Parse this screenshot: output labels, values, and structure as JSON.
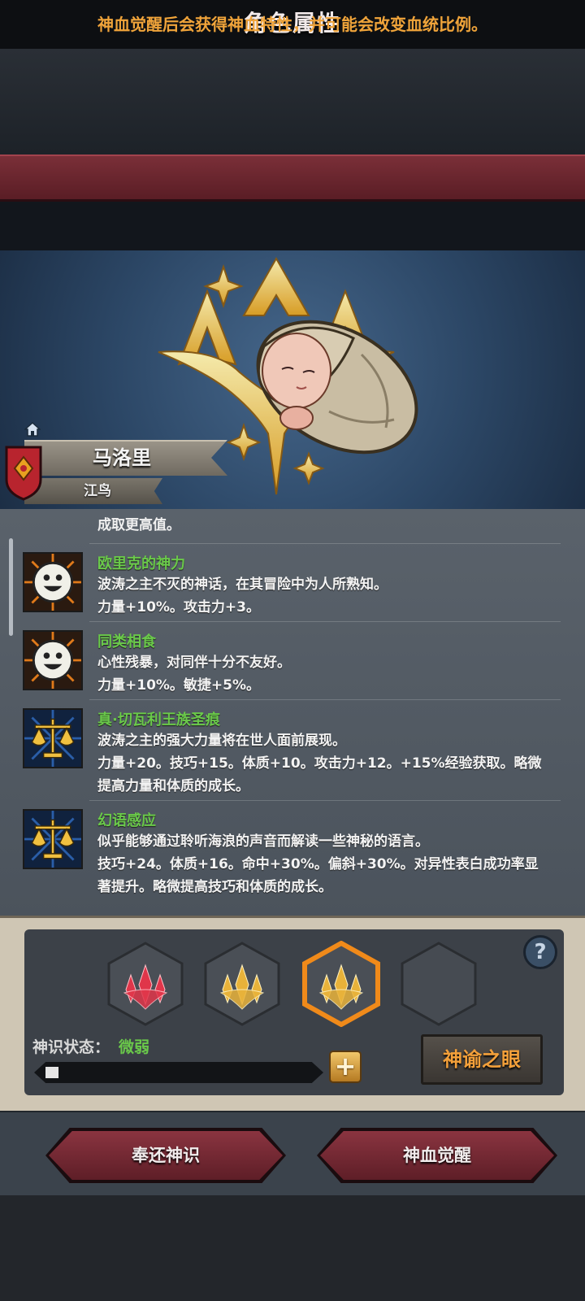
{
  "header": {
    "title": "角色属性"
  },
  "notice": "神血觉醒后会获得神血特性，并可能会改变血统比例。",
  "character": {
    "name": "马洛里",
    "subtitle": "江鸟"
  },
  "traits": {
    "cut_text": "成取更高值。",
    "items": [
      {
        "name": "欧里克的神力",
        "lines": [
          "波涛之主不灭的神话，在其冒险中为人所熟知。",
          "力量+10%。攻击力+3。"
        ],
        "icon": "smiley-face-icon",
        "color": "#e07a1a"
      },
      {
        "name": "同类相食",
        "lines": [
          "心性残暴，对同伴十分不友好。",
          "力量+10%。敏捷+5%。"
        ],
        "icon": "smiley-face-icon",
        "color": "#e07a1a"
      },
      {
        "name": "真·切瓦利王族圣痕",
        "lines": [
          "波涛之主的强大力量将在世人面前展现。",
          "力量+20。技巧+15。体质+10。攻击力+12。+15%经验获取。略微",
          "提高力量和体质的成长。"
        ],
        "icon": "scales-icon",
        "color": "#2a5ea8"
      },
      {
        "name": "幻语感应",
        "lines": [
          "似乎能够通过聆听海浪的声音而解读一些神秘的语言。",
          "技巧+24。体质+16。命中+30%。偏斜+30%。对异性表白成功率显",
          "著提升。略微提高技巧和体质的成长。"
        ],
        "icon": "scales-icon",
        "color": "#2a5ea8"
      }
    ]
  },
  "awaken_panel": {
    "slots": [
      {
        "icon": "red-crystal-crown-icon",
        "color": "#e0364a",
        "selected": false
      },
      {
        "icon": "gold-crystal-crown-icon",
        "color": "#e8b23a",
        "selected": false
      },
      {
        "icon": "gold-crystal-crown-icon",
        "color": "#e8b23a",
        "selected": true
      },
      {
        "icon": "empty-slot",
        "color": "#4a4f56",
        "selected": false
      }
    ],
    "help": "?",
    "state_label": "神识状态：",
    "state_value": "微弱",
    "progress": 0.04,
    "plus": "+",
    "oracle_button": "神谕之眼"
  },
  "actions": {
    "return": "奉还神识",
    "awaken": "神血觉醒"
  }
}
